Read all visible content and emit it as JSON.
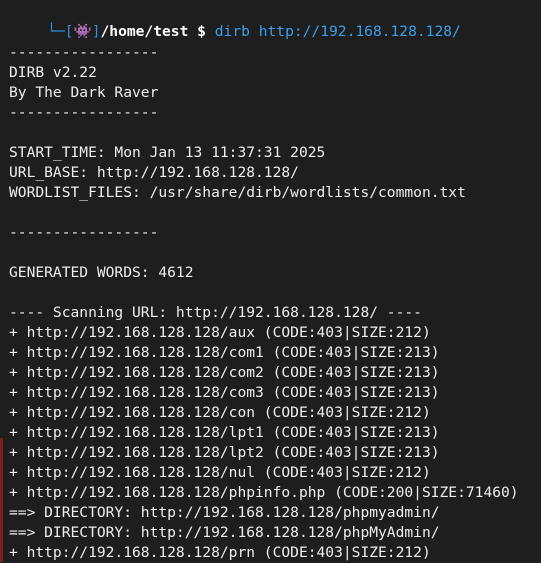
{
  "prompt": {
    "tree": "└─",
    "open_bracket": "[",
    "icon": "👾",
    "close_bracket": "]",
    "cwd": "/home/test",
    "symbol": "$",
    "command": "dirb",
    "argument": "http://192.168.128.128/"
  },
  "output": {
    "sep1": "-----------------",
    "banner": "DIRB v2.22",
    "author": "By The Dark Raver",
    "sep2": "-----------------",
    "start_time": "START_TIME: Mon Jan 13 11:37:31 2025",
    "url_base": "URL_BASE: http://192.168.128.128/",
    "wordlist": "WORDLIST_FILES: /usr/share/dirb/wordlists/common.txt",
    "sep3": "-----------------",
    "generated": "GENERATED WORDS: 4612",
    "scanning": "---- Scanning URL: http://192.168.128.128/ ----",
    "results": [
      "+ http://192.168.128.128/aux (CODE:403|SIZE:212)",
      "+ http://192.168.128.128/com1 (CODE:403|SIZE:213)",
      "+ http://192.168.128.128/com2 (CODE:403|SIZE:213)",
      "+ http://192.168.128.128/com3 (CODE:403|SIZE:213)",
      "+ http://192.168.128.128/con (CODE:403|SIZE:212)",
      "+ http://192.168.128.128/lpt1 (CODE:403|SIZE:213)",
      "+ http://192.168.128.128/lpt2 (CODE:403|SIZE:213)",
      "+ http://192.168.128.128/nul (CODE:403|SIZE:212)",
      "+ http://192.168.128.128/phpinfo.php (CODE:200|SIZE:71460)",
      "==> DIRECTORY: http://192.168.128.128/phpmyadmin/",
      "==> DIRECTORY: http://192.168.128.128/phpMyAdmin/",
      "+ http://192.168.128.128/prn (CODE:403|SIZE:212)"
    ]
  },
  "colors": {
    "background": "#1e1e1e",
    "text": "#eeeeee",
    "prompt_blue": "#2f8fd8",
    "command_blue": "#39a0e8",
    "icon_purple": "#d060e0"
  }
}
